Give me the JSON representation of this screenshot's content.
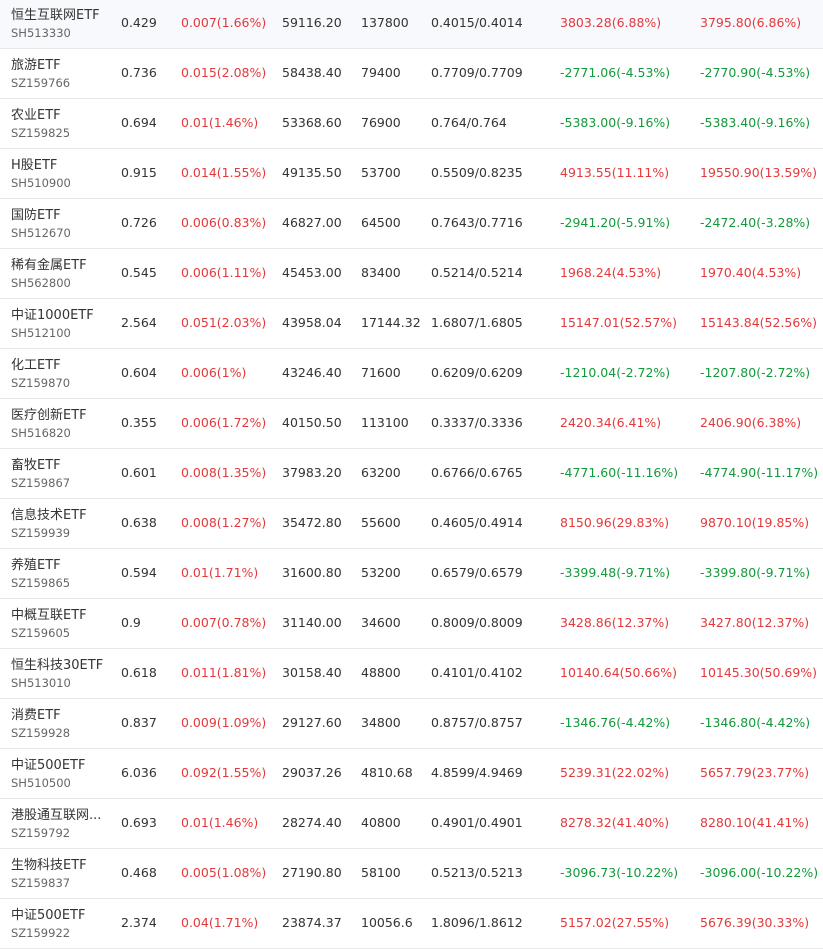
{
  "rows": [
    {
      "name": "恒生互联网ETF",
      "code": "SH513330",
      "price": "0.429",
      "change": "0.007(1.66%)",
      "amount": "59116.20",
      "volume": "137800",
      "cost": "0.4015/0.4014",
      "profit1": "3803.28(6.88%)",
      "profit1_dir": "up",
      "profit2": "3795.80(6.86%)",
      "profit2_dir": "up"
    },
    {
      "name": "旅游ETF",
      "code": "SZ159766",
      "price": "0.736",
      "change": "0.015(2.08%)",
      "amount": "58438.40",
      "volume": "79400",
      "cost": "0.7709/0.7709",
      "profit1": "-2771.06(-4.53%)",
      "profit1_dir": "down",
      "profit2": "-2770.90(-4.53%)",
      "profit2_dir": "down"
    },
    {
      "name": "农业ETF",
      "code": "SZ159825",
      "price": "0.694",
      "change": "0.01(1.46%)",
      "amount": "53368.60",
      "volume": "76900",
      "cost": "0.764/0.764",
      "profit1": "-5383.00(-9.16%)",
      "profit1_dir": "down",
      "profit2": "-5383.40(-9.16%)",
      "profit2_dir": "down"
    },
    {
      "name": "H股ETF",
      "code": "SH510900",
      "price": "0.915",
      "change": "0.014(1.55%)",
      "amount": "49135.50",
      "volume": "53700",
      "cost": "0.5509/0.8235",
      "profit1": "4913.55(11.11%)",
      "profit1_dir": "up",
      "profit2": "19550.90(13.59%)",
      "profit2_dir": "up"
    },
    {
      "name": "国防ETF",
      "code": "SH512670",
      "price": "0.726",
      "change": "0.006(0.83%)",
      "amount": "46827.00",
      "volume": "64500",
      "cost": "0.7643/0.7716",
      "profit1": "-2941.20(-5.91%)",
      "profit1_dir": "down",
      "profit2": "-2472.40(-3.28%)",
      "profit2_dir": "down"
    },
    {
      "name": "稀有金属ETF",
      "code": "SH562800",
      "price": "0.545",
      "change": "0.006(1.11%)",
      "amount": "45453.00",
      "volume": "83400",
      "cost": "0.5214/0.5214",
      "profit1": "1968.24(4.53%)",
      "profit1_dir": "up",
      "profit2": "1970.40(4.53%)",
      "profit2_dir": "up"
    },
    {
      "name": "中证1000ETF",
      "code": "SH512100",
      "price": "2.564",
      "change": "0.051(2.03%)",
      "amount": "43958.04",
      "volume": "17144.32",
      "cost": "1.6807/1.6805",
      "profit1": "15147.01(52.57%)",
      "profit1_dir": "up",
      "profit2": "15143.84(52.56%)",
      "profit2_dir": "up"
    },
    {
      "name": "化工ETF",
      "code": "SZ159870",
      "price": "0.604",
      "change": "0.006(1%)",
      "amount": "43246.40",
      "volume": "71600",
      "cost": "0.6209/0.6209",
      "profit1": "-1210.04(-2.72%)",
      "profit1_dir": "down",
      "profit2": "-1207.80(-2.72%)",
      "profit2_dir": "down"
    },
    {
      "name": "医疗创新ETF",
      "code": "SH516820",
      "price": "0.355",
      "change": "0.006(1.72%)",
      "amount": "40150.50",
      "volume": "113100",
      "cost": "0.3337/0.3336",
      "profit1": "2420.34(6.41%)",
      "profit1_dir": "up",
      "profit2": "2406.90(6.38%)",
      "profit2_dir": "up"
    },
    {
      "name": "畜牧ETF",
      "code": "SZ159867",
      "price": "0.601",
      "change": "0.008(1.35%)",
      "amount": "37983.20",
      "volume": "63200",
      "cost": "0.6766/0.6765",
      "profit1": "-4771.60(-11.16%)",
      "profit1_dir": "down",
      "profit2": "-4774.90(-11.17%)",
      "profit2_dir": "down"
    },
    {
      "name": "信息技术ETF",
      "code": "SZ159939",
      "price": "0.638",
      "change": "0.008(1.27%)",
      "amount": "35472.80",
      "volume": "55600",
      "cost": "0.4605/0.4914",
      "profit1": "8150.96(29.83%)",
      "profit1_dir": "up",
      "profit2": "9870.10(19.85%)",
      "profit2_dir": "up"
    },
    {
      "name": "养殖ETF",
      "code": "SZ159865",
      "price": "0.594",
      "change": "0.01(1.71%)",
      "amount": "31600.80",
      "volume": "53200",
      "cost": "0.6579/0.6579",
      "profit1": "-3399.48(-9.71%)",
      "profit1_dir": "down",
      "profit2": "-3399.80(-9.71%)",
      "profit2_dir": "down"
    },
    {
      "name": "中概互联ETF",
      "code": "SZ159605",
      "price": "0.9",
      "change": "0.007(0.78%)",
      "amount": "31140.00",
      "volume": "34600",
      "cost": "0.8009/0.8009",
      "profit1": "3428.86(12.37%)",
      "profit1_dir": "up",
      "profit2": "3427.80(12.37%)",
      "profit2_dir": "up"
    },
    {
      "name": "恒生科技30ETF",
      "code": "SH513010",
      "price": "0.618",
      "change": "0.011(1.81%)",
      "amount": "30158.40",
      "volume": "48800",
      "cost": "0.4101/0.4102",
      "profit1": "10140.64(50.66%)",
      "profit1_dir": "up",
      "profit2": "10145.30(50.69%)",
      "profit2_dir": "up"
    },
    {
      "name": "消费ETF",
      "code": "SZ159928",
      "price": "0.837",
      "change": "0.009(1.09%)",
      "amount": "29127.60",
      "volume": "34800",
      "cost": "0.8757/0.8757",
      "profit1": "-1346.76(-4.42%)",
      "profit1_dir": "down",
      "profit2": "-1346.80(-4.42%)",
      "profit2_dir": "down"
    },
    {
      "name": "中证500ETF",
      "code": "SH510500",
      "price": "6.036",
      "change": "0.092(1.55%)",
      "amount": "29037.26",
      "volume": "4810.68",
      "cost": "4.8599/4.9469",
      "profit1": "5239.31(22.02%)",
      "profit1_dir": "up",
      "profit2": "5657.79(23.77%)",
      "profit2_dir": "up"
    },
    {
      "name": "港股通互联网...",
      "code": "SZ159792",
      "price": "0.693",
      "change": "0.01(1.46%)",
      "amount": "28274.40",
      "volume": "40800",
      "cost": "0.4901/0.4901",
      "profit1": "8278.32(41.40%)",
      "profit1_dir": "up",
      "profit2": "8280.10(41.41%)",
      "profit2_dir": "up"
    },
    {
      "name": "生物科技ETF",
      "code": "SZ159837",
      "price": "0.468",
      "change": "0.005(1.08%)",
      "amount": "27190.80",
      "volume": "58100",
      "cost": "0.5213/0.5213",
      "profit1": "-3096.73(-10.22%)",
      "profit1_dir": "down",
      "profit2": "-3096.00(-10.22%)",
      "profit2_dir": "down"
    },
    {
      "name": "中证500ETF",
      "code": "SZ159922",
      "price": "2.374",
      "change": "0.04(1.71%)",
      "amount": "23874.37",
      "volume": "10056.6",
      "cost": "1.8096/1.8612",
      "profit1": "5157.02(27.55%)",
      "profit1_dir": "up",
      "profit2": "5676.39(30.33%)",
      "profit2_dir": "up"
    }
  ]
}
